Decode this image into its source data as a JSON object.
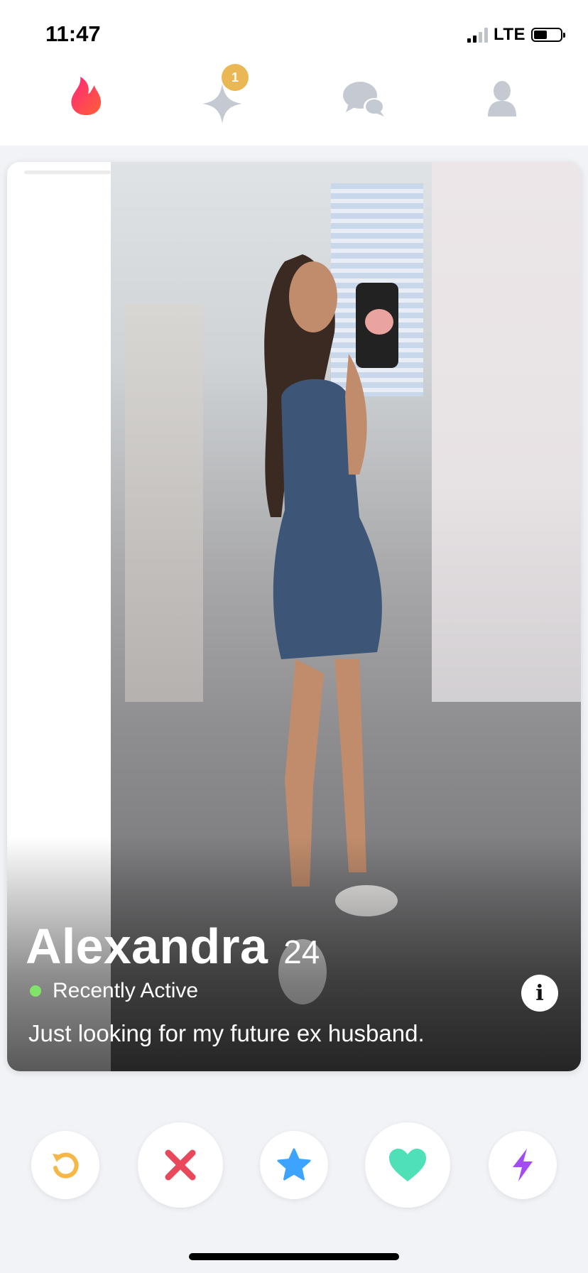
{
  "status_bar": {
    "time": "11:47",
    "network": "LTE"
  },
  "nav": {
    "items": [
      {
        "name": "flame-icon",
        "active": true
      },
      {
        "name": "sparkle-icon",
        "badge": "1"
      },
      {
        "name": "chat-icon"
      },
      {
        "name": "profile-icon"
      }
    ]
  },
  "profile": {
    "name": "Alexandra",
    "age": "24",
    "status": "Recently Active",
    "bio": "Just looking for my future ex husband."
  },
  "actions": [
    {
      "name": "rewind-button",
      "icon": "rewind-icon",
      "color": "#f5b748"
    },
    {
      "name": "nope-button",
      "icon": "x-icon",
      "color": "#e9475a"
    },
    {
      "name": "super-like-button",
      "icon": "star-icon",
      "color": "#3ca4ff"
    },
    {
      "name": "like-button",
      "icon": "heart-icon",
      "color": "#4fe0b8"
    },
    {
      "name": "boost-button",
      "icon": "bolt-icon",
      "color": "#a34cf3"
    }
  ],
  "colors": {
    "brand": "#fe3c72",
    "nav_inactive": "#c4c9d2",
    "badge": "#e9b754",
    "active_dot": "#82e36a"
  }
}
